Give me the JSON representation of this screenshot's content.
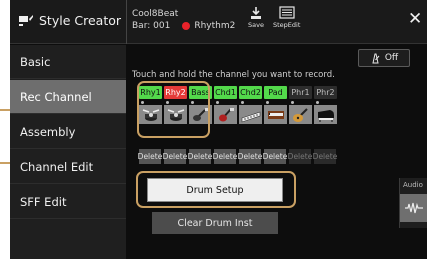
{
  "header": {
    "app_title": "Style Creator",
    "style_name": "Cool8Beat",
    "bar": "Bar: 001",
    "rec_part": "Rhythm2",
    "save_label": "Save",
    "stepedit_label": "StepEdit"
  },
  "sidebar": {
    "items": [
      {
        "label": "Basic"
      },
      {
        "label": "Rec Channel"
      },
      {
        "label": "Assembly"
      },
      {
        "label": "Channel Edit"
      },
      {
        "label": "SFF Edit"
      }
    ]
  },
  "main": {
    "off_label": "Off",
    "instruction": "Touch and hold the channel you want to record.",
    "channels": [
      {
        "label": "Rhy1",
        "state": "green",
        "icon": "drum-kit-icon"
      },
      {
        "label": "Rhy2",
        "state": "red",
        "icon": "drum-kit-icon"
      },
      {
        "label": "Bass",
        "state": "green",
        "icon": "bass-guitar-icon"
      },
      {
        "label": "Chd1",
        "state": "green",
        "icon": "electric-guitar-icon"
      },
      {
        "label": "Chd2",
        "state": "green",
        "icon": "keyboard-icon"
      },
      {
        "label": "Pad",
        "state": "green",
        "icon": "organ-icon"
      },
      {
        "label": "Phr1",
        "state": "dim",
        "icon": "acoustic-guitar-icon"
      },
      {
        "label": "Phr2",
        "state": "dim",
        "icon": "grand-piano-icon"
      }
    ],
    "delete_label": "Delete",
    "drum_setup_label": "Drum Setup",
    "clear_drum_label": "Clear Drum Inst",
    "audio_label": "Audio"
  },
  "colors": {
    "accent_callout": "#c9a063",
    "channel_active": "#53d94b",
    "channel_recording": "#e43a38"
  }
}
